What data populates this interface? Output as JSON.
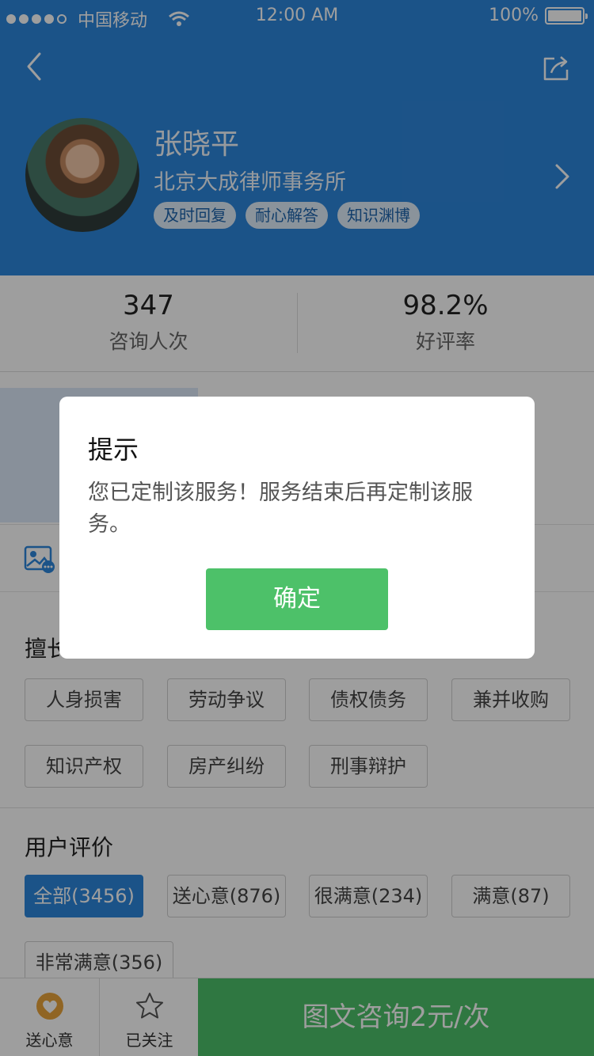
{
  "status_bar": {
    "carrier": "中国移动",
    "time": "12:00 AM",
    "battery": "100%"
  },
  "profile": {
    "name": "张晓平",
    "firm": "北京大成律师事务所",
    "tags": [
      "及时回复",
      "耐心解答",
      "知识渊博"
    ]
  },
  "stats": {
    "consult_count": "347",
    "consult_label": "咨询人次",
    "rating": "98.2%",
    "rating_label": "好评率"
  },
  "expertise": {
    "title": "擅长",
    "items": [
      "人身损害",
      "劳动争议",
      "债权债务",
      "兼并收购",
      "知识产权",
      "房产纠纷",
      "刑事辩护"
    ]
  },
  "reviews": {
    "title": "用户评价",
    "filters": [
      "全部(3456)",
      "送心意(876)",
      "很满意(234)",
      "满意(87)",
      "非常满意(356)"
    ]
  },
  "bottom_bar": {
    "gift_label": "送心意",
    "follow_label": "已关注",
    "consult_label": "图文咨询2元/次"
  },
  "dialog": {
    "title": "提示",
    "message": "您已定制该服务！服务结束后再定制该服务。",
    "confirm": "确定"
  },
  "colors": {
    "primary": "#2d86db",
    "accent_green": "#4dc169",
    "heart_orange": "#e8a43a"
  }
}
